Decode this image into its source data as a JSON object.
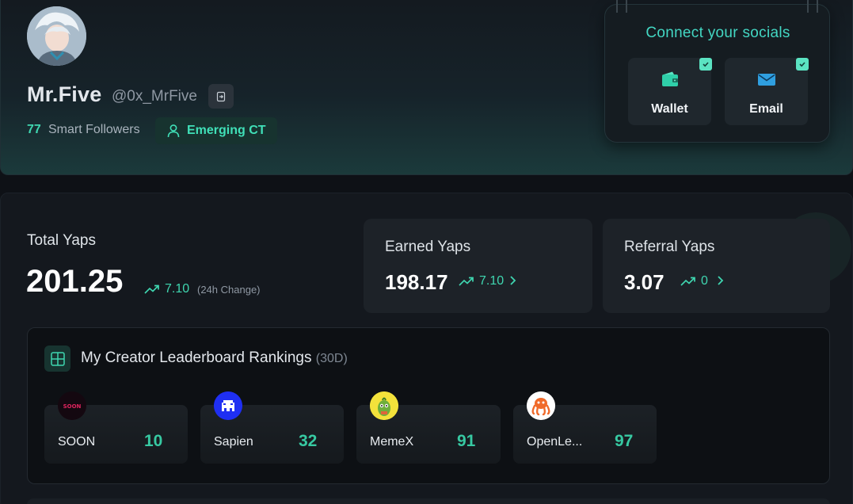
{
  "profile": {
    "name": "Mr.Five",
    "handle": "@0x_MrFive",
    "smart_followers_count": "77",
    "smart_followers_label": "Smart Followers",
    "badge_label": "Emerging CT",
    "badge_icon": "user-icon"
  },
  "socials": {
    "title": "Connect your socials",
    "items": [
      {
        "label": "Wallet",
        "icon": "wallet-icon",
        "connected": true
      },
      {
        "label": "Email",
        "icon": "mail-icon",
        "connected": true
      }
    ]
  },
  "yaps": {
    "total": {
      "label": "Total Yaps",
      "value": "201.25",
      "change": "7.10",
      "change_note": "(24h Change)"
    },
    "earned": {
      "label": "Earned Yaps",
      "value": "198.17",
      "change": "7.10"
    },
    "referral": {
      "label": "Referral Yaps",
      "value": "3.07",
      "change": "0"
    }
  },
  "rankings": {
    "title": "My Creator Leaderboard Rankings",
    "period": "(30D)",
    "items": [
      {
        "name": "SOON",
        "rank": "10",
        "logo_text": "SOON"
      },
      {
        "name": "Sapien",
        "rank": "32"
      },
      {
        "name": "MemeX",
        "rank": "91"
      },
      {
        "name": "OpenLe...",
        "rank": "97"
      }
    ]
  },
  "colors": {
    "accent": "#3fd6b0",
    "background": "#0e1116",
    "card": "#1d2228"
  }
}
